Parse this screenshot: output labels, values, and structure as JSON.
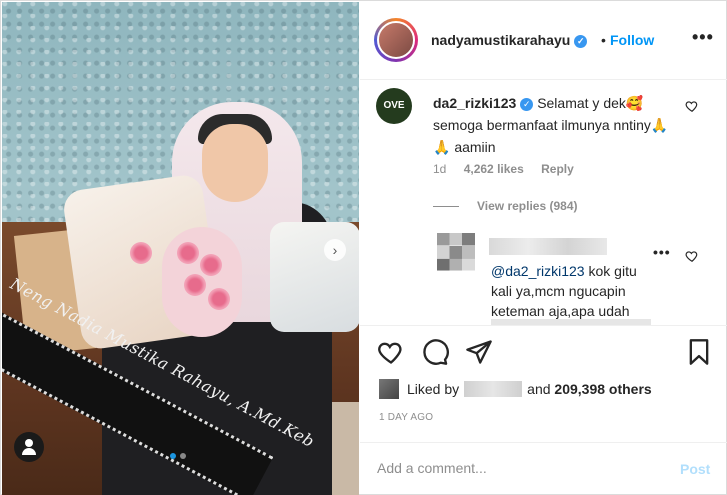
{
  "post": {
    "image_alt": "",
    "sash_text": "Neng Nadia Mustika Rahayu, A.Md.Keb",
    "carousel_pages": 2,
    "carousel_active": 1
  },
  "header": {
    "username": "nadyamustikarahayu",
    "separator": "•",
    "follow_label": "Follow",
    "more_label": "•••"
  },
  "comment": {
    "avatar_text": "OVE",
    "username": "da2_rizki123",
    "text": "Selamat y dek🥰 semoga bermanfaat ilmunya nntiny🙏🙏 aamiin",
    "age": "1d",
    "likes": "4,262 likes",
    "reply_label": "Reply",
    "view_replies": "View replies (984)"
  },
  "reply": {
    "mention": "@da2_rizki123",
    "text": " kok gitu kali ya,mcm ngucapin keteman aja,apa udah",
    "more_label": "•••"
  },
  "likes": {
    "prefix": "Liked by",
    "joiner": "and",
    "count": "209,398 others"
  },
  "date": "1 DAY AGO",
  "add_comment": {
    "placeholder": "Add a comment...",
    "post_label": "Post"
  },
  "colors": {
    "accent": "#0095f6",
    "verified": "#3897f0",
    "post_disabled": "#b2dffc"
  }
}
